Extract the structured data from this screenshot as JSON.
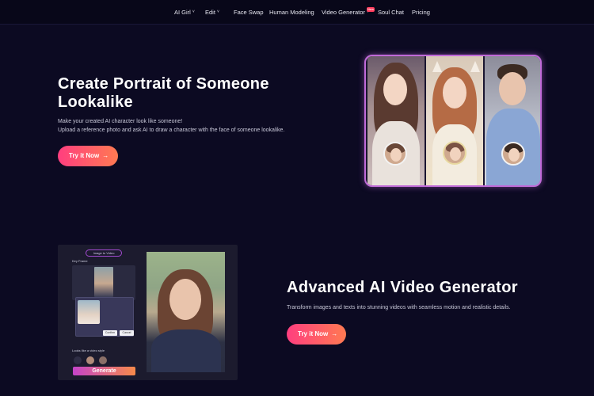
{
  "nav": {
    "items": [
      {
        "label": "AI Girl",
        "caret": true
      },
      {
        "label": "Edit",
        "caret": true
      },
      {
        "label": "Face Swap",
        "caret": false
      },
      {
        "label": "Human Modeling",
        "caret": false
      },
      {
        "label": "Video Generator",
        "caret": true
      },
      {
        "label": "Soul Chat",
        "caret": false
      },
      {
        "label": "Pricing",
        "caret": false
      }
    ],
    "new_badge": "New",
    "caret_glyph": "˅"
  },
  "hero": {
    "title": "Create Portrait of Someone Lookalike",
    "desc_line1": "Make your created AI character look like someone!",
    "desc_line2": "Upload a reference photo and ask AI to draw a character with the face of someone lookalike.",
    "cta": "Try it Now",
    "cta_arrow": "→"
  },
  "video": {
    "title": "Advanced AI Video Generator",
    "desc": "Transform images and texts into stunning videos with seamless motion and realistic details.",
    "cta": "Try it Now",
    "cta_arrow": "→",
    "mock": {
      "chip": "Image to Video",
      "key_frame_label": "Key Frame",
      "confirm": "Confirm",
      "cancel": "Cancel",
      "looks_label": "Looks like a video style",
      "generate": "Generate"
    }
  },
  "colors": {
    "background": "#0c0a22",
    "cta_gradient_start": "#ff3e7f",
    "cta_gradient_end": "#ff7a52",
    "frame_border": "#c06ad8"
  }
}
